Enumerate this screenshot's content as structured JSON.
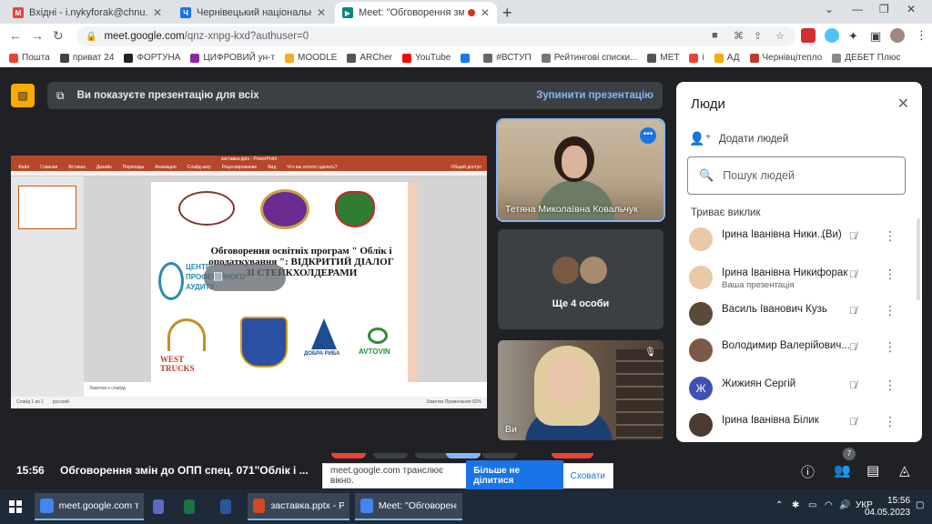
{
  "browser": {
    "tabs": [
      {
        "title": "Вхідні - i.nykyforak@chnu.edu.u",
        "favicon": "gmail-icon"
      },
      {
        "title": "Чернівецький національний ун",
        "favicon": "site-icon"
      },
      {
        "title": "Meet: \"Обговорення змін д",
        "favicon": "meet-icon",
        "active": true
      }
    ],
    "newtab": "+",
    "url_host": "meet.google.com",
    "url_path": "/qnz-xnpg-kxd?authuser=0",
    "bookmarks": [
      {
        "label": "Пошта",
        "color": "#ea4335"
      },
      {
        "label": "приват 24",
        "color": "#444"
      },
      {
        "label": "ФОРТУНА",
        "color": "#222"
      },
      {
        "label": "ЦИФРОВИЙ ун-т",
        "color": "#8e24aa"
      },
      {
        "label": "MOODLE",
        "color": "#f9a825"
      },
      {
        "label": "ARCher",
        "color": "#555"
      },
      {
        "label": "YouTube",
        "color": "#ff0000"
      },
      {
        "label": "",
        "color": "#1877f2"
      },
      {
        "label": "#ВСТУП",
        "color": "#666"
      },
      {
        "label": "Рейтингові списки...",
        "color": "#777"
      },
      {
        "label": "МЕТ",
        "color": "#555"
      },
      {
        "label": "і",
        "color": "#ea4335"
      },
      {
        "label": "АД",
        "color": "#f9ab00"
      },
      {
        "label": "Чернівцітепло",
        "color": "#c0392b"
      },
      {
        "label": "ДЕБЕТ Плюс",
        "color": "#8a8a8a"
      }
    ]
  },
  "meet": {
    "presenting_text": "Ви показуєте презентацію для всіх",
    "stop_label": "Зупинити презентацію",
    "time": "15:56",
    "meeting_title": "Обговорення змін до ОПП спец. 071\"Облік і ...",
    "share_notice": "meet.google.com транслює вікно.",
    "share_stop": "Більше не ділитися",
    "share_cancel": "Сховати",
    "people_count": "7"
  },
  "ppt": {
    "window_title": "заставка.pptx - PowerPoint",
    "ribbon": [
      "Файл",
      "Главная",
      "Вставка",
      "Дизайн",
      "Переходы",
      "Анимация",
      "Слайд-шоу",
      "Рецензирование",
      "Вид",
      "Что вы хотите сделать?"
    ],
    "share": "Общий доступ",
    "notes": "Заметки к слайду",
    "status_left": "Слайд 1 из 1",
    "status_lang": "русский",
    "status_right": "Заметки   Примечания   82%",
    "slide_title": "Обговорення освітніх програм \" Облік і оподаткування \": ВІДКРИТИЙ ДІАЛОГ ЗІ СТЕЙКХОЛДЕРАМИ",
    "cpa_text": "ЦЕНТР ПРОФЕСІЙНОГО АУДИТУ",
    "west_trucks": "WEST TRUCKS",
    "dobra_ryba": "ДОБРА РИБА",
    "avtovin": "AVTOVIN"
  },
  "tiles": {
    "speaker_name": "Тетяна Миколаївна Ковальчук",
    "others_label": "Ще 4 особи",
    "self_label": "Ви"
  },
  "people": {
    "title": "Люди",
    "add_label": "Додати людей",
    "search_placeholder": "Пошук людей",
    "section": "Триває виклик",
    "you_tag": "(Ви)",
    "list": [
      {
        "name": "Ірина Іванівна Ники...",
        "sub": "",
        "color": "#e9c9a8"
      },
      {
        "name": "Ірина Іванівна Никифорак",
        "sub": "Ваша презентація",
        "color": "#e9c9a8"
      },
      {
        "name": "Василь Іванович Кузь",
        "sub": "",
        "color": "#5a4a3a"
      },
      {
        "name": "Володимир Валерійович...",
        "sub": "",
        "color": "#7a5a44"
      },
      {
        "name": "Жижиян Сергій",
        "sub": "",
        "color": "#3f51b5",
        "initial": "Ж"
      },
      {
        "name": "Ірина Іванівна Білик",
        "sub": "",
        "color": "#4a3a30"
      }
    ]
  },
  "taskbar": {
    "items": [
      {
        "label": "meet.google.com т...",
        "icon": "chrome-icon",
        "color": "#4285f4",
        "wide": true
      },
      {
        "label": "",
        "icon": "save-icon",
        "color": "#5c6bc0",
        "wide": false
      },
      {
        "label": "",
        "icon": "excel-icon",
        "color": "#1e7145",
        "wide": false
      },
      {
        "label": "",
        "icon": "word-icon",
        "color": "#2b579a",
        "wide": false
      },
      {
        "label": "заставка.pptx - Ро...",
        "icon": "powerpoint-icon",
        "color": "#d24726",
        "wide": true
      },
      {
        "label": "Meet: \"Обговоренн...",
        "icon": "chrome-icon",
        "color": "#4285f4",
        "wide": true
      }
    ],
    "lang": "УКР",
    "clock_time": "15:56",
    "clock_date": "04.05.2023"
  }
}
